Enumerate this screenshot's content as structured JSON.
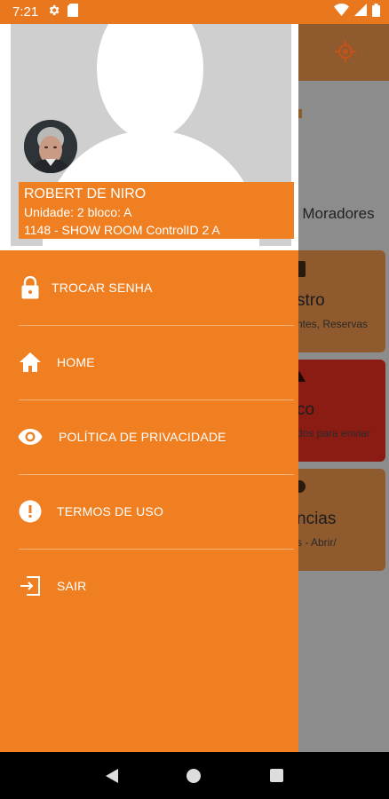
{
  "status_bar": {
    "time": "7:21"
  },
  "user": {
    "name": "ROBERT DE NIRO",
    "unit": "Unidade: 2 bloco: A",
    "location": "1148 - SHOW ROOM ControlID 2 A"
  },
  "menu": [
    {
      "label": "TROCAR SENHA",
      "icon": "lock-icon"
    },
    {
      "label": "HOME",
      "icon": "home-icon"
    },
    {
      "label": "POLÍTICA DE PRIVACIDADE",
      "icon": "eye-icon"
    },
    {
      "label": "TERMOS DE USO",
      "icon": "alert-icon"
    },
    {
      "label": "SAIR",
      "icon": "logout-icon"
    }
  ],
  "background": {
    "moradores": "r Moradores",
    "cards": [
      {
        "title": "stro",
        "subtitle": "ntes, Reservas"
      },
      {
        "title": "co",
        "subtitle": "dos para enviar"
      },
      {
        "title": "ncias",
        "subtitle": "s - Abrir/"
      }
    ]
  },
  "colors": {
    "primary": "#f07f21",
    "status_bar": "#e8771e",
    "alert_card": "#8a1c14"
  }
}
